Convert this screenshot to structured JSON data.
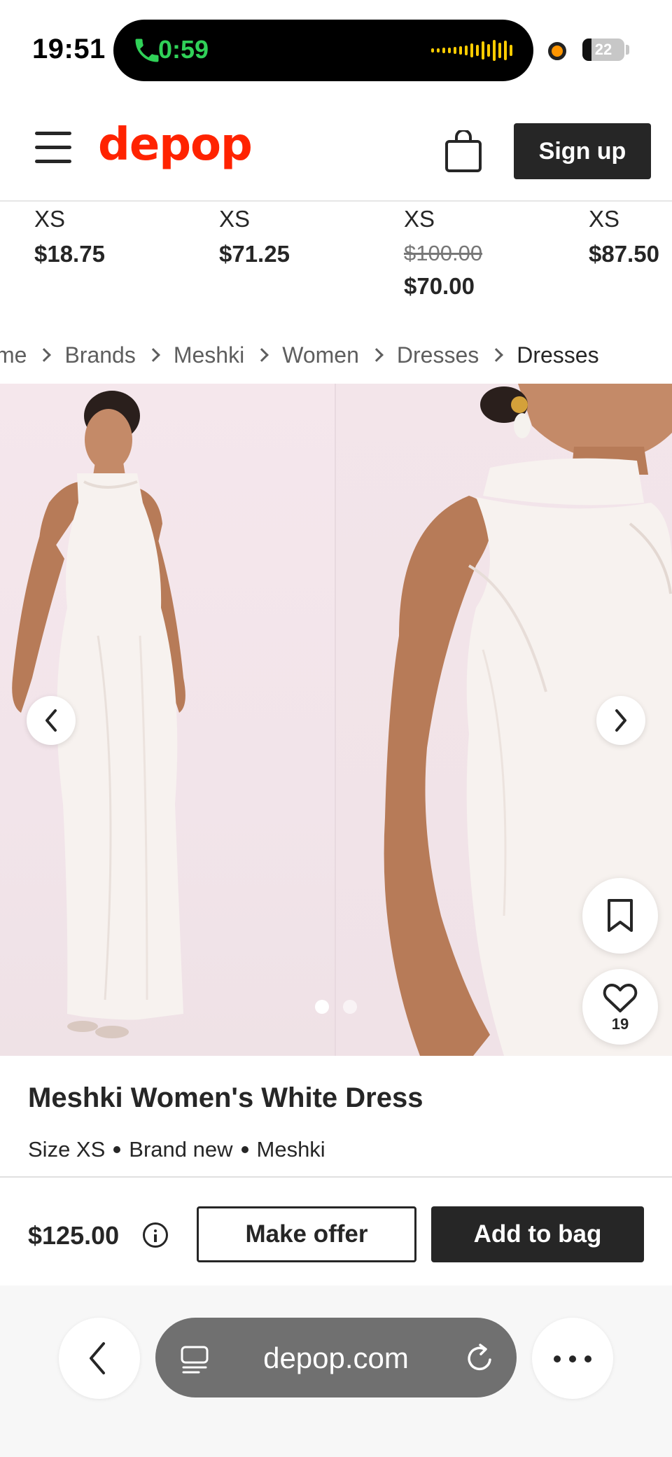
{
  "status_bar": {
    "time": "19:51",
    "call_timer": "0:59",
    "battery": "22"
  },
  "header": {
    "logo": "depop",
    "signup_label": "Sign up"
  },
  "related_items": [
    {
      "size": "XS",
      "price": "$18.75"
    },
    {
      "size": "XS",
      "price": "$71.25"
    },
    {
      "size": "XS",
      "original_price": "$100.00",
      "price": "$70.00"
    },
    {
      "size": "XS",
      "price": "$87.50"
    }
  ],
  "breadcrumb": [
    "me",
    "Brands",
    "Meshki",
    "Women",
    "Dresses",
    "Dresses"
  ],
  "gallery": {
    "photo_count": 2,
    "active_index": 0,
    "likes": "19"
  },
  "product": {
    "title": "Meshki Women's White Dress",
    "size": "Size XS",
    "condition": "Brand new",
    "brand": "Meshki",
    "price": "$125.00"
  },
  "actions": {
    "offer_label": "Make offer",
    "add_label": "Add to bag"
  },
  "browser": {
    "url": "depop.com"
  },
  "colors": {
    "brand": "#ff2300",
    "dark": "#262626",
    "call_green": "#30d158"
  }
}
